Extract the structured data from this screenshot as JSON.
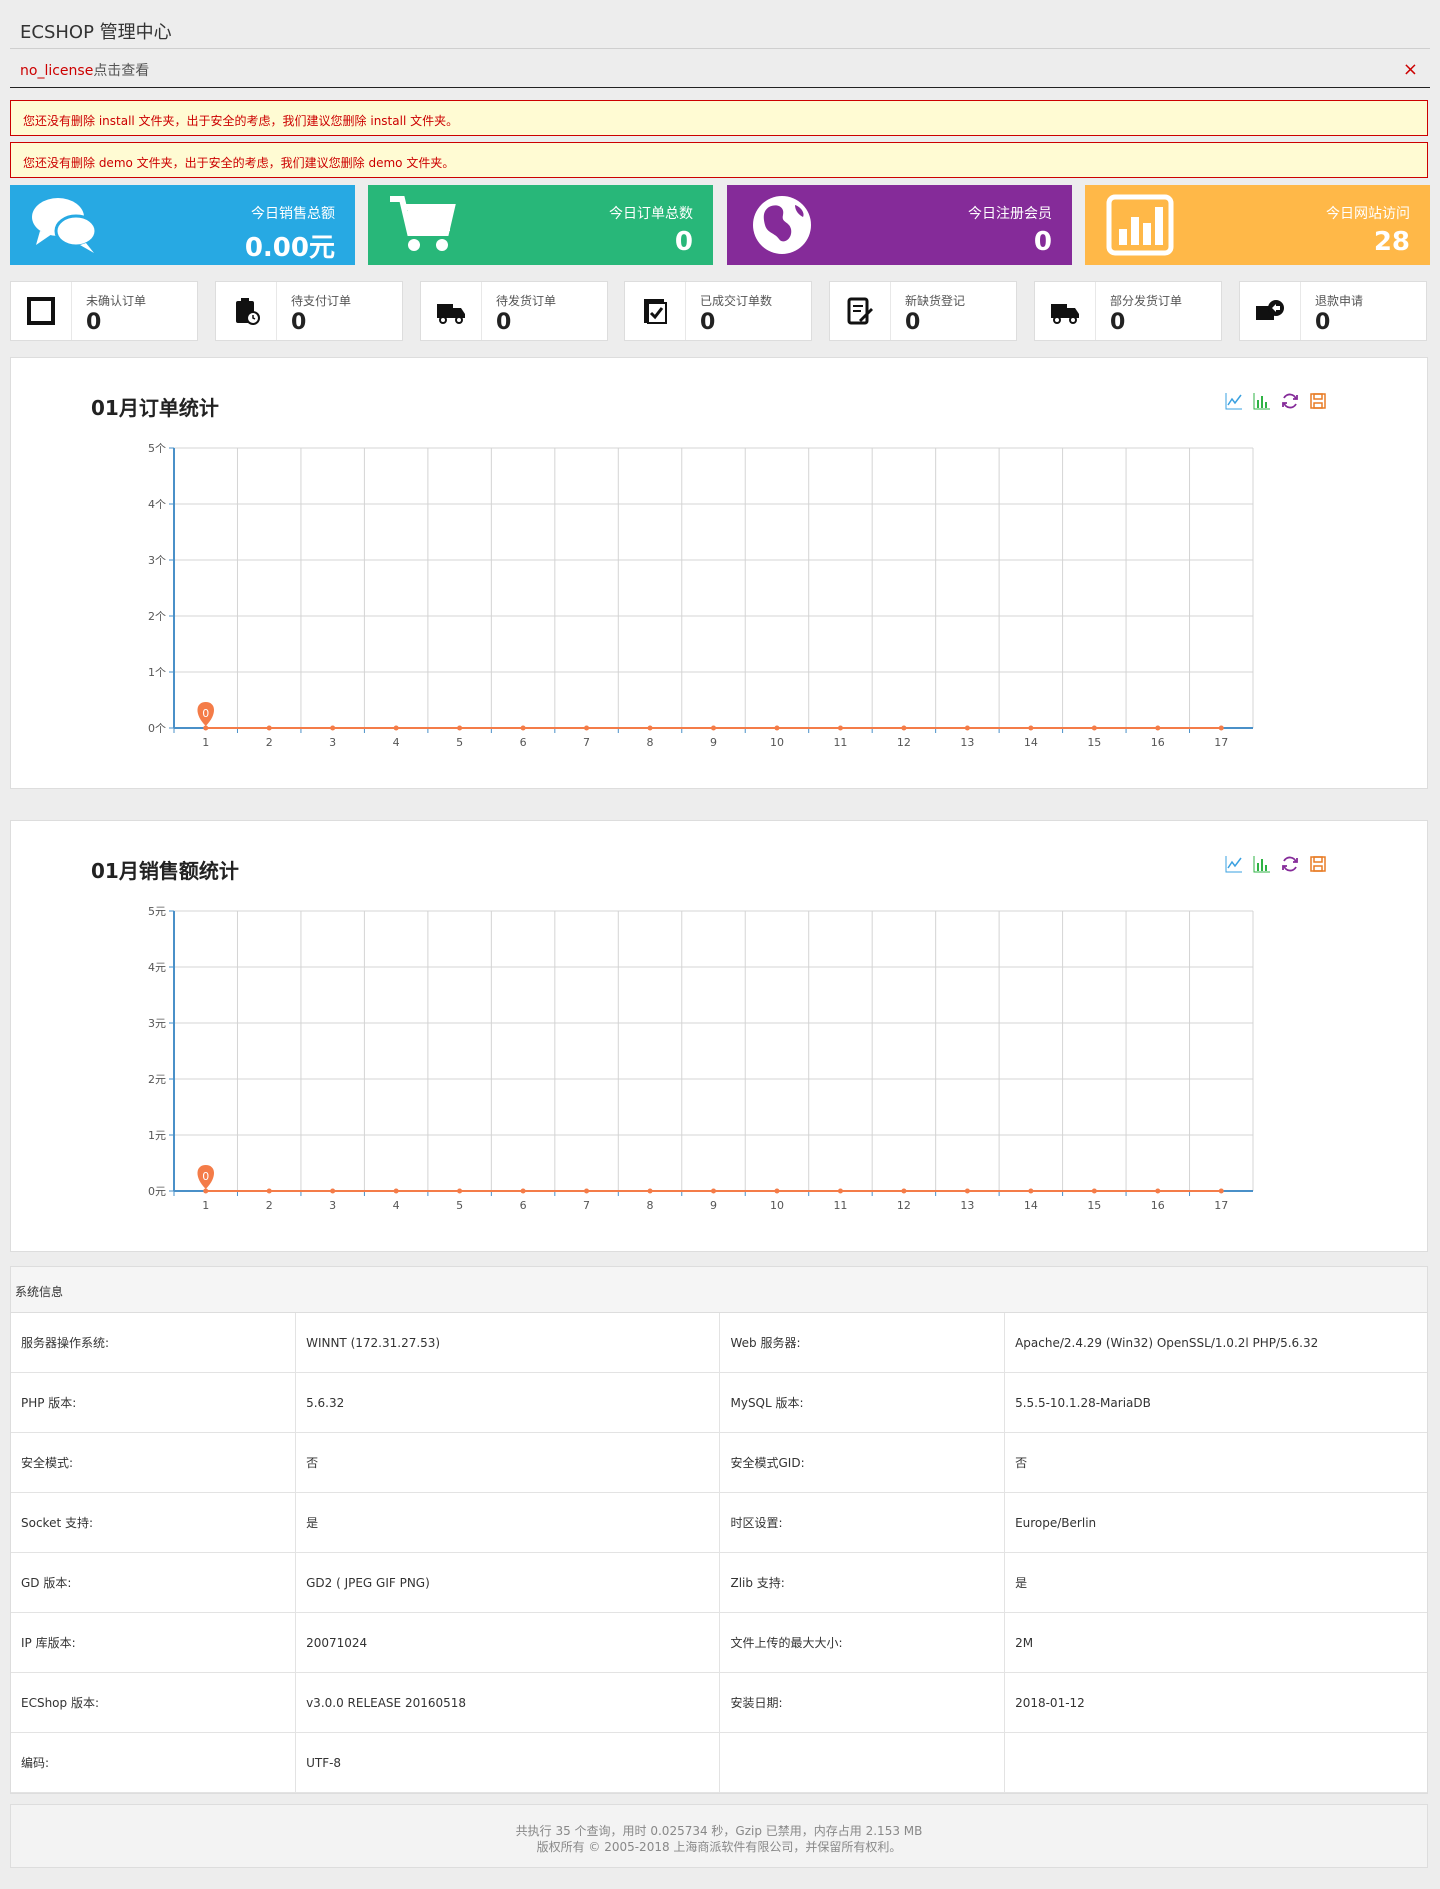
{
  "header": {
    "title": "ECSHOP 管理中心"
  },
  "license": {
    "link": "no_license",
    "suffix": "点击查看",
    "close": "×"
  },
  "alerts": [
    "您还没有删除 install 文件夹，出于安全的考虑，我们建议您删除 install 文件夹。",
    "您还没有删除 demo 文件夹，出于安全的考虑，我们建议您删除 demo 文件夹。"
  ],
  "stats": [
    {
      "label": "今日销售总额",
      "value": "0.00元",
      "color": "#27a9e3",
      "icon": "chat-bubbles-icon"
    },
    {
      "label": "今日订单总数",
      "value": "0",
      "color": "#28b779",
      "icon": "shopping-cart-icon"
    },
    {
      "label": "今日注册会员",
      "value": "0",
      "color": "#852b99",
      "icon": "globe-icon"
    },
    {
      "label": "今日网站访问",
      "value": "28",
      "color": "#ffb848",
      "icon": "bar-chart-icon"
    }
  ],
  "mini": [
    {
      "label": "未确认订单",
      "value": "0",
      "icon": "unconfirmed-order-icon"
    },
    {
      "label": "待支付订单",
      "value": "0",
      "icon": "clipboard-clock-icon"
    },
    {
      "label": "待发货订单",
      "value": "0",
      "icon": "delivery-truck-icon"
    },
    {
      "label": "已成交订单数",
      "value": "0",
      "icon": "order-check-icon"
    },
    {
      "label": "新缺货登记",
      "value": "0",
      "icon": "edit-note-icon"
    },
    {
      "label": "部分发货订单",
      "value": "0",
      "icon": "partial-truck-icon"
    },
    {
      "label": "退款申请",
      "value": "0",
      "icon": "refund-icon"
    }
  ],
  "chart_data": [
    {
      "type": "line",
      "title": "01月订单统计",
      "x": [
        "1",
        "2",
        "3",
        "4",
        "5",
        "6",
        "7",
        "8",
        "9",
        "10",
        "11",
        "12",
        "13",
        "14",
        "15",
        "16",
        "17"
      ],
      "series": [
        {
          "values": [
            0,
            0,
            0,
            0,
            0,
            0,
            0,
            0,
            0,
            0,
            0,
            0,
            0,
            0,
            0,
            0,
            0
          ]
        }
      ],
      "ylim": [
        0,
        5
      ],
      "yticks": [
        "0个",
        "1个",
        "2个",
        "3个",
        "4个",
        "5个"
      ],
      "marker_label": "0",
      "grid": true,
      "line_color": "#4a90c8",
      "point_color": "#f47c48"
    },
    {
      "type": "line",
      "title": "01月销售额统计",
      "x": [
        "1",
        "2",
        "3",
        "4",
        "5",
        "6",
        "7",
        "8",
        "9",
        "10",
        "11",
        "12",
        "13",
        "14",
        "15",
        "16",
        "17"
      ],
      "series": [
        {
          "values": [
            0,
            0,
            0,
            0,
            0,
            0,
            0,
            0,
            0,
            0,
            0,
            0,
            0,
            0,
            0,
            0,
            0
          ]
        }
      ],
      "ylim": [
        0,
        5
      ],
      "yticks": [
        "0元",
        "1元",
        "2元",
        "3元",
        "4元",
        "5元"
      ],
      "marker_label": "0",
      "grid": true,
      "line_color": "#4a90c8",
      "point_color": "#f47c48"
    }
  ],
  "sysinfo": {
    "title": "系统信息",
    "rows": [
      [
        "服务器操作系统:",
        "WINNT (172.31.27.53)",
        "Web 服务器:",
        "Apache/2.4.29 (Win32) OpenSSL/1.0.2l PHP/5.6.32"
      ],
      [
        "PHP 版本:",
        "5.6.32",
        "MySQL 版本:",
        "5.5.5-10.1.28-MariaDB"
      ],
      [
        "安全模式:",
        "否",
        "安全模式GID:",
        "否"
      ],
      [
        "Socket 支持:",
        "是",
        "时区设置:",
        "Europe/Berlin"
      ],
      [
        "GD 版本:",
        "GD2 ( JPEG GIF PNG)",
        "Zlib 支持:",
        "是"
      ],
      [
        "IP 库版本:",
        "20071024",
        "文件上传的最大大小:",
        "2M"
      ],
      [
        "ECShop 版本:",
        "v3.0.0 RELEASE 20160518",
        "安装日期:",
        "2018-01-12"
      ],
      [
        "编码:",
        "UTF-8",
        "",
        ""
      ]
    ]
  },
  "footer": {
    "line1": "共执行 35 个查询，用时 0.025734 秒，Gzip 已禁用，内存占用 2.153 MB",
    "line2": "版权所有 © 2005-2018 上海商派软件有限公司，并保留所有权利。"
  }
}
